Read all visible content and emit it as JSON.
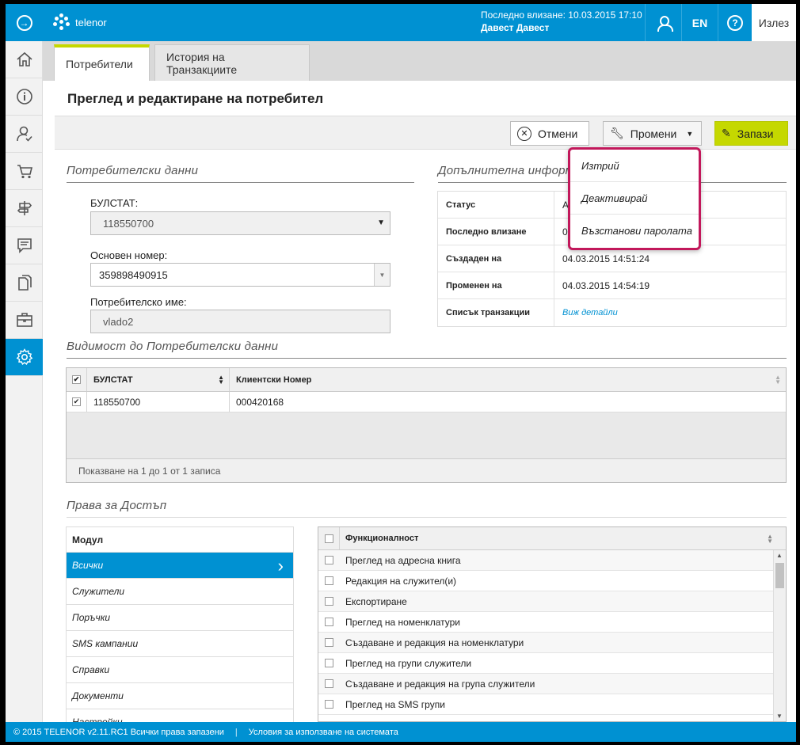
{
  "topbar": {
    "brand": "telenor",
    "last_login": "Последно влизане: 10.03.2015 17:10",
    "user_name": "Давест Давест",
    "lang": "EN",
    "help": "?",
    "exit": "Излез"
  },
  "tabs": [
    {
      "label": "Потребители"
    },
    {
      "label": "История на Транзакциите"
    }
  ],
  "page_title": "Преглед и редактиране на потребител",
  "actions": {
    "cancel": "Отмени",
    "change": "Промени",
    "save": "Запази"
  },
  "change_menu": [
    "Изтрий",
    "Деактивирай",
    "Възстанови паролата"
  ],
  "user_data": {
    "section": "Потребителски данни",
    "bulstat_label": "БУЛСТАТ:",
    "bulstat_value": "118550700",
    "main_number_label": "Основен номер:",
    "main_number_value": "359898490915",
    "username_label": "Потребителско име:",
    "username_value": "vlado2"
  },
  "extra_info": {
    "section": "Допълнителна информ",
    "rows": [
      {
        "key": "Статус",
        "value": "А"
      },
      {
        "key": "Последно влизане",
        "value": "0"
      },
      {
        "key": "Създаден на",
        "value": "04.03.2015 14:51:24"
      },
      {
        "key": "Променен на",
        "value": "04.03.2015 14:54:19"
      },
      {
        "key": "Списък транзакции",
        "value": "Виж детайли"
      }
    ]
  },
  "visibility": {
    "section": "Видимост до Потребителски данни",
    "col_bulstat": "БУЛСТАТ",
    "col_client": "Клиентски Номер",
    "rows": [
      {
        "bulstat": "118550700",
        "client": "000420168"
      }
    ],
    "footer": "Показване на 1 до 1 от 1 записа"
  },
  "access": {
    "section": "Права за Достъп",
    "module_header": "Модул",
    "modules": [
      "Всички",
      "Служители",
      "Поръчки",
      "SMS кампании",
      "Справки",
      "Документи",
      "Настройки"
    ],
    "func_header": "Функционалност",
    "functions": [
      "Преглед на адресна книга",
      "Редакция на служител(и)",
      "Експортиране",
      "Преглед на номенклатури",
      "Създаване и редакция на номенклатури",
      "Преглед на групи служители",
      "Създаване и редакция на група служители",
      "Преглед на SMS групи"
    ]
  },
  "footer": {
    "copyright": "© 2015 TELENOR v2.11.RC1 Всички права запазени",
    "terms": "Условия за използване на системата"
  },
  "colors": {
    "primary": "#0091d2",
    "accent": "#c5d800",
    "menu_border": "#c2185b"
  }
}
